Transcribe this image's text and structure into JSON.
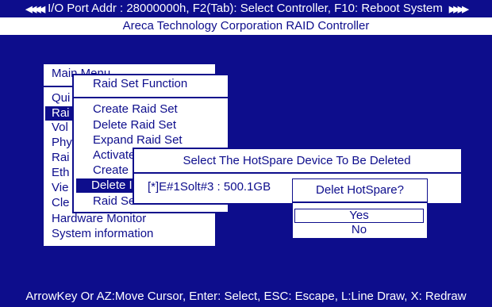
{
  "header": {
    "left_arrows": "◀◀◀◀",
    "title": "I/O Port Addr : 28000000h, F2(Tab): Select Controller, F10: Reboot System",
    "right_arrows": "▶▶▶▶",
    "subtitle": "Areca Technology Corporation RAID Controller"
  },
  "main_menu": {
    "title": "Main Menu",
    "items": [
      "Qui",
      "Rai",
      "Vol",
      "Phy",
      "Rai",
      "Eth",
      "Vie",
      "Cle",
      "Hardware Monitor",
      "System information"
    ]
  },
  "raid_set_function": {
    "title": "Raid Set Function",
    "items": [
      "Create Raid Set",
      "Delete Raid Set",
      "Expand Raid Set",
      "Activate",
      "Create",
      "Delete I",
      "Raid Se"
    ]
  },
  "hotspare_dialog": {
    "title": "Select The HotSpare Device To Be Deleted",
    "device": "[*]E#1Solt#3 : 500.1GB"
  },
  "confirm_dialog": {
    "title": "Delet HotSpare?",
    "yes": "Yes",
    "no": "No"
  },
  "status_bar": "ArrowKey Or AZ:Move Cursor, Enter: Select, ESC: Escape, L:Line Draw, X: Redraw",
  "colors": {
    "background": "#0d0d8c",
    "panel": "#ffffff",
    "text": "#0d0d8c"
  }
}
